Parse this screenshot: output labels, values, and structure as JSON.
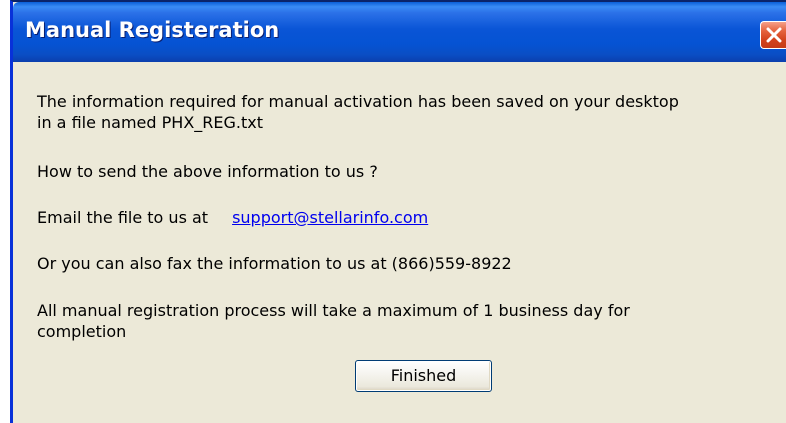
{
  "window": {
    "title": "Manual Registeration"
  },
  "message": {
    "line1": "The information required for manual activation has been saved on your desktop",
    "line2": "in a file named PHX_REG.txt",
    "question": "How to send the above information to us ?",
    "email_prefix": "Email the file  to us at",
    "email_link": "support@stellarinfo.com",
    "fax_text": "Or you can also fax the information  to us at   (866)559-8922",
    "duration_line1": "All manual registration process will take a maximum of 1 business day for",
    "duration_line2": "completion"
  },
  "buttons": {
    "finished_label": "Finished"
  },
  "icons": {
    "close": "close-icon"
  },
  "colors": {
    "titlebar": "#0553d3",
    "close": "#d3421c",
    "dialog_bg": "#ece9d8",
    "link": "#0000ee"
  }
}
